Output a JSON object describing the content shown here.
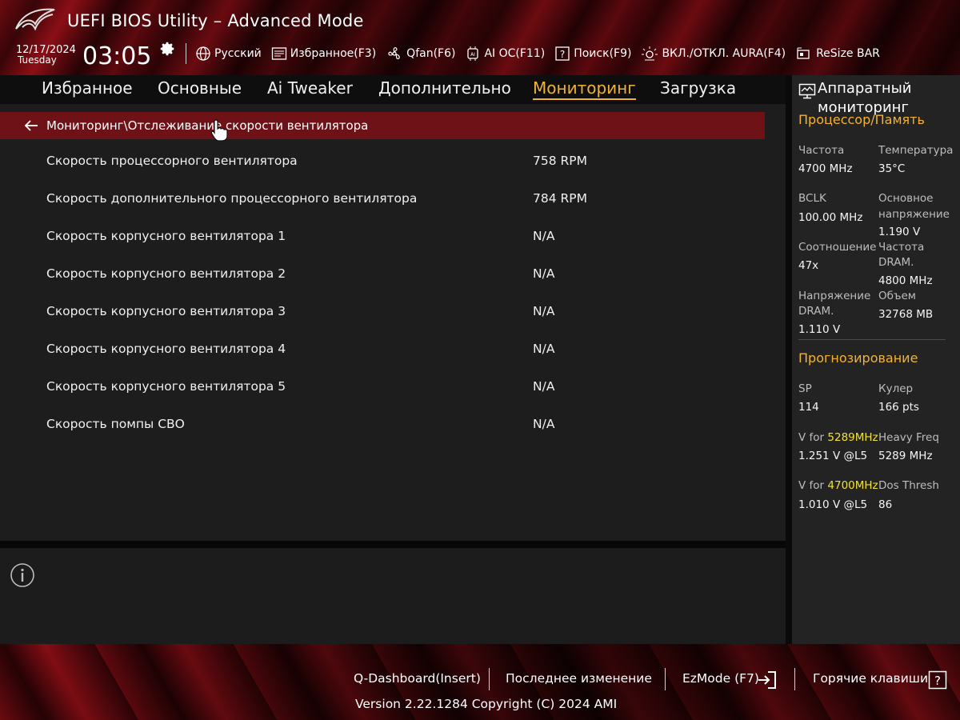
{
  "header": {
    "title": "UEFI BIOS Utility – Advanced Mode",
    "date": "12/17/2024",
    "day": "Tuesday",
    "time": "03:05"
  },
  "toolbar": {
    "items": [
      {
        "label": "Русский",
        "icon": "globe-icon"
      },
      {
        "label": "Избранное(F3)",
        "icon": "favorites-icon"
      },
      {
        "label": "Qfan(F6)",
        "icon": "fan-icon"
      },
      {
        "label": "AI OC(F11)",
        "icon": "chip-icon"
      },
      {
        "label": "Поиск(F9)",
        "icon": "help-box-icon"
      },
      {
        "label": "ВКЛ./ОТКЛ. AURA(F4)",
        "icon": "aura-icon"
      },
      {
        "label": "ReSize BAR",
        "icon": "resize-bar-icon"
      }
    ]
  },
  "nav": {
    "tabs": [
      {
        "label": "Избранное",
        "active": false
      },
      {
        "label": "Основные",
        "active": false
      },
      {
        "label": "Ai Tweaker",
        "active": false
      },
      {
        "label": "Дополнительно",
        "active": false
      },
      {
        "label": "Мониторинг",
        "active": true
      },
      {
        "label": "Загрузка",
        "active": false
      }
    ]
  },
  "main": {
    "breadcrumb": "Мониторинг\\Отслеживание скорости вентилятора",
    "rows": [
      {
        "label": "Скорость процессорного вентилятора",
        "value": "758 RPM"
      },
      {
        "label": "Скорость дополнительного процессорного вентилятора",
        "value": "784 RPM"
      },
      {
        "label": "Скорость корпусного вентилятора 1",
        "value": "N/A"
      },
      {
        "label": "Скорость корпусного вентилятора 2",
        "value": "N/A"
      },
      {
        "label": "Скорость корпусного вентилятора 3",
        "value": "N/A"
      },
      {
        "label": "Скорость корпусного вентилятора 4",
        "value": "N/A"
      },
      {
        "label": "Скорость корпусного вентилятора 5",
        "value": "N/A"
      },
      {
        "label": "Скорость помпы СВО",
        "value": "N/A"
      }
    ]
  },
  "monitor": {
    "title_line1": "Аппаратный",
    "title_line2": "мониторинг",
    "cpu_section": "Процессор/Память",
    "freq_label": "Частота",
    "freq_value": "4700 MHz",
    "temp_label": "Температура",
    "temp_value": "35°C",
    "bclk_label": "BCLK",
    "bclk_value": "100.00 MHz",
    "core_v_label1": "Основное",
    "core_v_label2": "напряжение",
    "core_v_value": "1.190 V",
    "ratio_label": "Соотношение",
    "ratio_value": "47x",
    "dram_f_label1": "Частота",
    "dram_f_label2": "DRAM.",
    "dram_f_value": "4800 MHz",
    "dram_v_label1": "Напряжение",
    "dram_v_label2": "DRAM.",
    "dram_v_value": "1.110 V",
    "cap_label": "Объем",
    "cap_value": "32768 MB",
    "pred_section": "Прогнозирование",
    "sp_label": "SP",
    "sp_value": "114",
    "cooler_label": "Кулер",
    "cooler_value": "166 pts",
    "vfor1_prefix": "V for ",
    "vfor1_freq": "5289MHz",
    "vfor1_value": "1.251 V @L5",
    "heavy_label": "Heavy Freq",
    "heavy_value": "5289 MHz",
    "vfor2_prefix": "V for ",
    "vfor2_freq": "4700MHz",
    "vfor2_value": "1.010 V @L5",
    "dos_label": "Dos Thresh",
    "dos_value": "86"
  },
  "footer": {
    "qdash": "Q-Dashboard(Insert)",
    "last_change": "Последнее изменение",
    "ezmode": "EzMode (F7)",
    "hotkeys": "Горячие клавиши",
    "version": "Version 2.22.1284 Copyright (C) 2024 AMI"
  },
  "colors": {
    "accent": "#f2b233",
    "highlight": "#f2e03a",
    "selection": "#6e1217"
  }
}
